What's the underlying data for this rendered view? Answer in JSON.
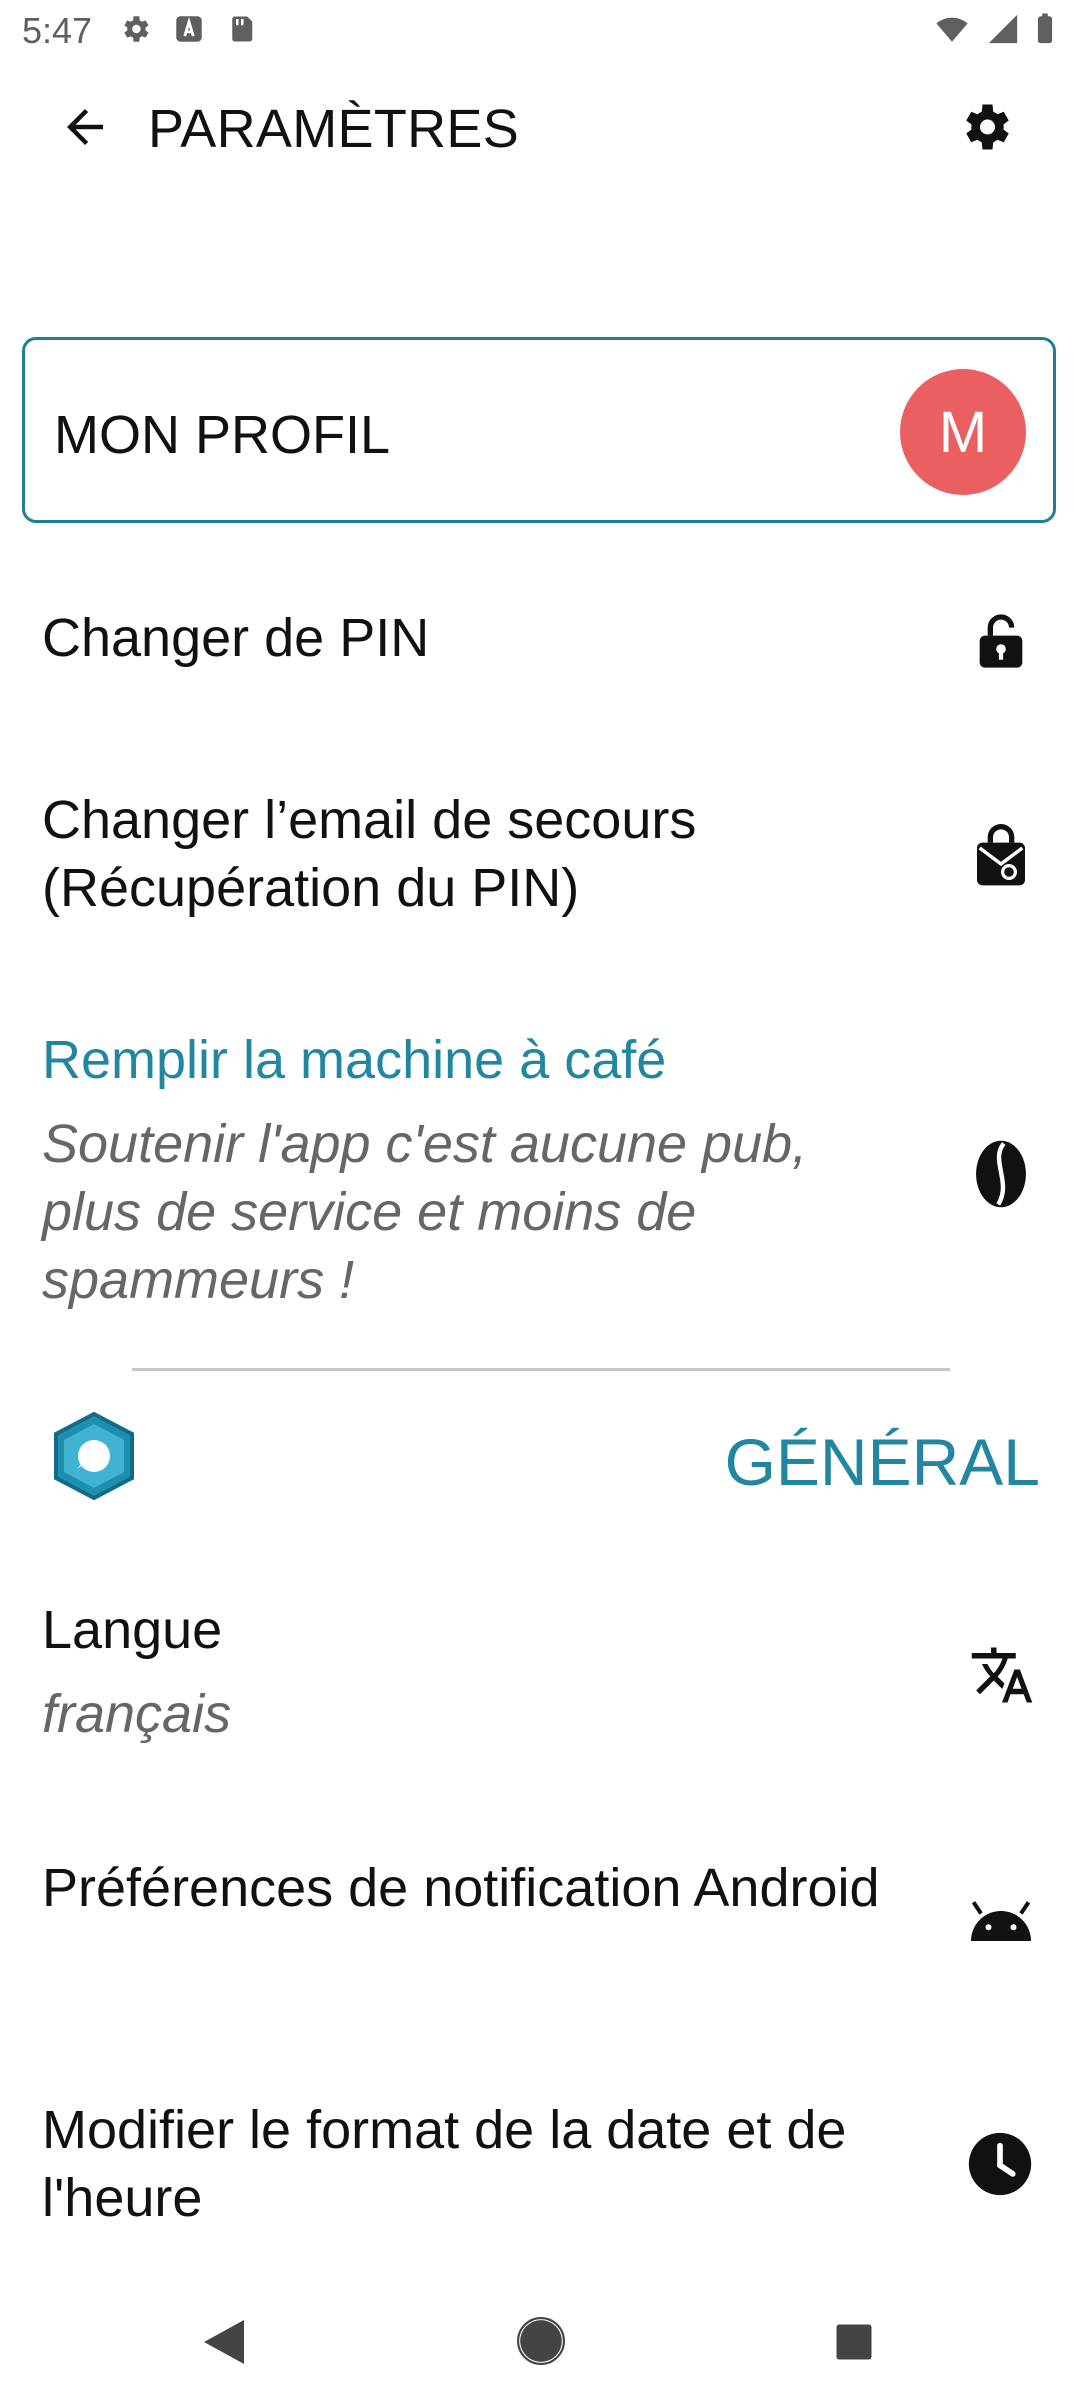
{
  "status_bar": {
    "time": "5:47"
  },
  "app_bar": {
    "title": "PARAMÈTRES"
  },
  "profile": {
    "label": "MON PROFIL",
    "avatar_initial": "M"
  },
  "items": {
    "change_pin": "Changer de PIN",
    "change_email": "Changer l’email de secours (Récupération du PIN)",
    "coffee_title": "Remplir la machine à café",
    "coffee_subtitle": "Soutenir l'app c'est aucune pub, plus de service et moins de spammeurs !",
    "language_title": "Langue",
    "language_value": "français",
    "notifications": "Préférences de notification Android",
    "date_format": "Modifier le format de la date et de l'heure"
  },
  "section": {
    "general": "GÉNÉRAL"
  },
  "colors": {
    "accent": "#2386a0",
    "card_border": "#1f7f95",
    "avatar": "#ea5f5f"
  },
  "icons": {
    "back": "arrow-left-icon",
    "settings": "gear-icon",
    "pin": "lock-open-icon",
    "email": "mail-lock-icon",
    "coffee": "coffee-bean-icon",
    "language": "translate-icon",
    "android": "android-icon",
    "date": "clock-icon"
  }
}
